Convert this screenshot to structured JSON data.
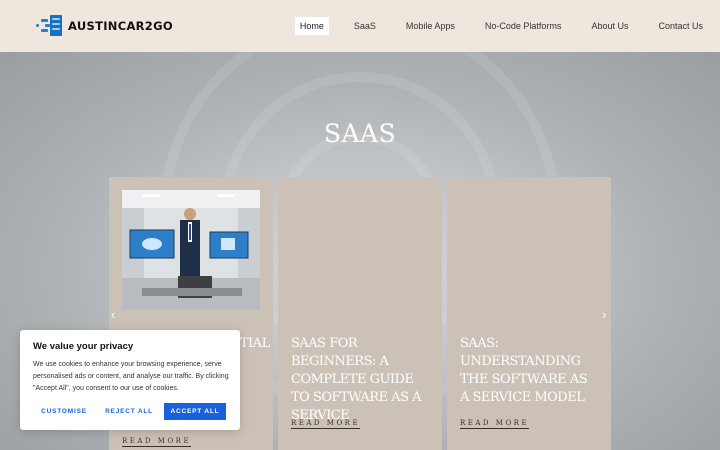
{
  "header": {
    "logo_text": "AUSTINCAR2GO",
    "nav": [
      {
        "label": "Home",
        "active": true
      },
      {
        "label": "SaaS"
      },
      {
        "label": "Mobile Apps"
      },
      {
        "label": "No-Code Platforms"
      },
      {
        "label": "About Us"
      },
      {
        "label": "Contact Us"
      }
    ]
  },
  "page": {
    "title": "SAAS"
  },
  "cards": [
    {
      "title": "",
      "title_visible_fragment": "NTIAL",
      "read_more": "READ MORE"
    },
    {
      "title": "SAAS FOR BEGINNERS: A COMPLETE GUIDE TO SOFTWARE AS A SERVICE",
      "read_more": "READ MORE"
    },
    {
      "title": "SAAS: UNDERSTANDING THE SOFTWARE AS A SERVICE MODEL",
      "read_more": "READ MORE"
    }
  ],
  "carousel": {
    "prev_icon": "chevron-left-icon",
    "next_icon": "chevron-right-icon"
  },
  "cookie": {
    "title": "We value your privacy",
    "text": "We use cookies to enhance your browsing experience, serve personalised ads or content, and analyse our traffic. By clicking \"Accept All\", you consent to our use of cookies.",
    "customise": "CUSTOMISE",
    "reject": "REJECT ALL",
    "accept": "ACCEPT ALL"
  },
  "colors": {
    "header_bg": "#efe6dd",
    "card_bg": "#cbc1b6",
    "accent": "#1863dc",
    "logo_blue": "#1e7fd8"
  }
}
